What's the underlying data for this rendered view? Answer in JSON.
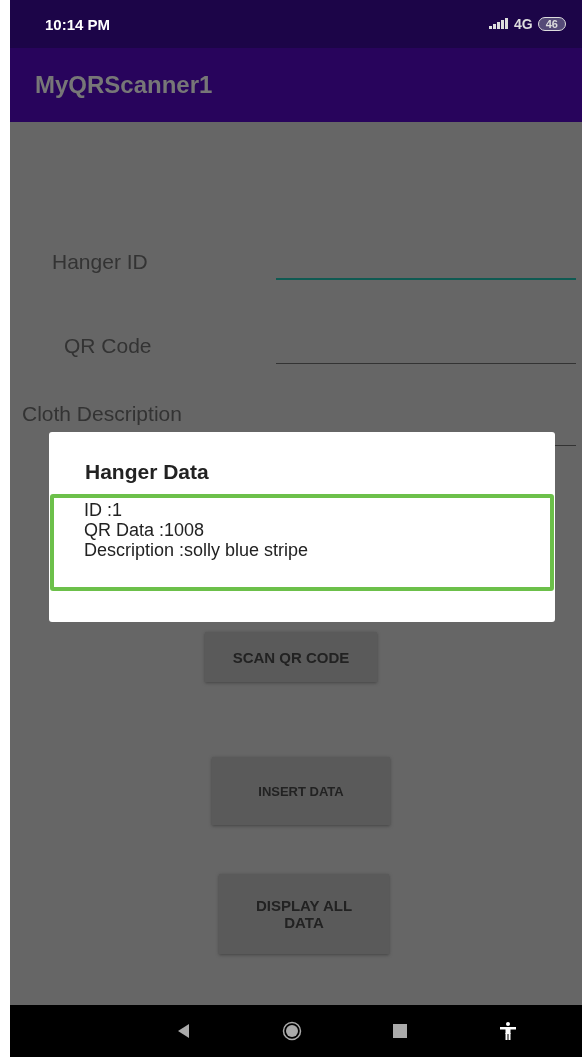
{
  "status_bar": {
    "time": "10:14 PM",
    "network": "4G",
    "battery": "46"
  },
  "app_bar": {
    "title": "MyQRScanner1"
  },
  "fields": [
    {
      "label": "Hanger ID",
      "focused": true
    },
    {
      "label": "QR Code",
      "focused": false
    },
    {
      "label": "Cloth Description",
      "focused": false
    }
  ],
  "buttons": [
    "SCAN QR CODE",
    "INSERT DATA",
    "DISPLAY ALL DATA"
  ],
  "dialog": {
    "title": "Hanger Data",
    "lines": [
      "ID :1",
      "QR Data :1008",
      "Description :solly blue stripe"
    ]
  }
}
